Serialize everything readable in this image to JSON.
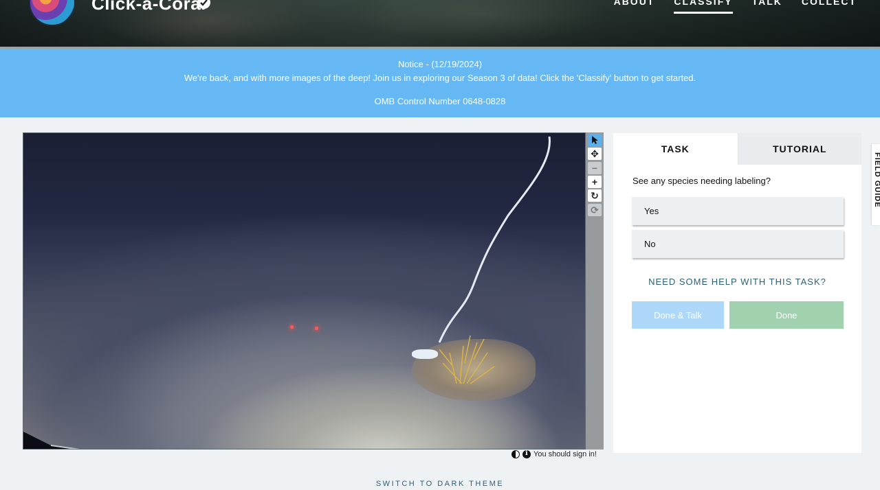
{
  "header": {
    "project_title": "Click-a-Coral",
    "nav": [
      {
        "label": "ABOUT"
      },
      {
        "label": "CLASSIFY"
      },
      {
        "label": "TALK"
      },
      {
        "label": "COLLECT"
      }
    ],
    "active_nav": "CLASSIFY"
  },
  "notice": {
    "line1": "Notice - (12/19/2024)",
    "line2": "We're back, and with more images of the deep! Join us in exploring our Season 3 of data! Click the 'Classify' button to get started.",
    "line3": "OMB Control Number 0648-0828",
    "background": "#65b8f4"
  },
  "viewer": {
    "tools": [
      {
        "icon": "pointer-icon",
        "state": "active"
      },
      {
        "icon": "move-icon",
        "state": "normal"
      },
      {
        "icon": "zoom-out-icon",
        "state": "disabled"
      },
      {
        "icon": "zoom-in-icon",
        "state": "normal"
      },
      {
        "icon": "rotate-icon",
        "state": "normal"
      },
      {
        "icon": "reset-icon",
        "state": "disabled"
      }
    ],
    "sign_in_message": "You should sign in!"
  },
  "task_panel": {
    "tabs": [
      {
        "label": "TASK",
        "active": true
      },
      {
        "label": "TUTORIAL",
        "active": false
      }
    ],
    "question": "See any species needing labeling?",
    "answers": [
      {
        "label": "Yes"
      },
      {
        "label": "No"
      }
    ],
    "help_link": "NEED SOME HELP WITH THIS TASK?",
    "done_talk_label": "Done & Talk",
    "done_label": "Done",
    "colors": {
      "done_talk": "#add8f9",
      "done": "#a2d1b0",
      "help": "#2e5f74"
    }
  },
  "field_guide": {
    "label": "FIELD GUIDE"
  },
  "footer": {
    "theme_toggle": "SWITCH TO DARK THEME"
  }
}
